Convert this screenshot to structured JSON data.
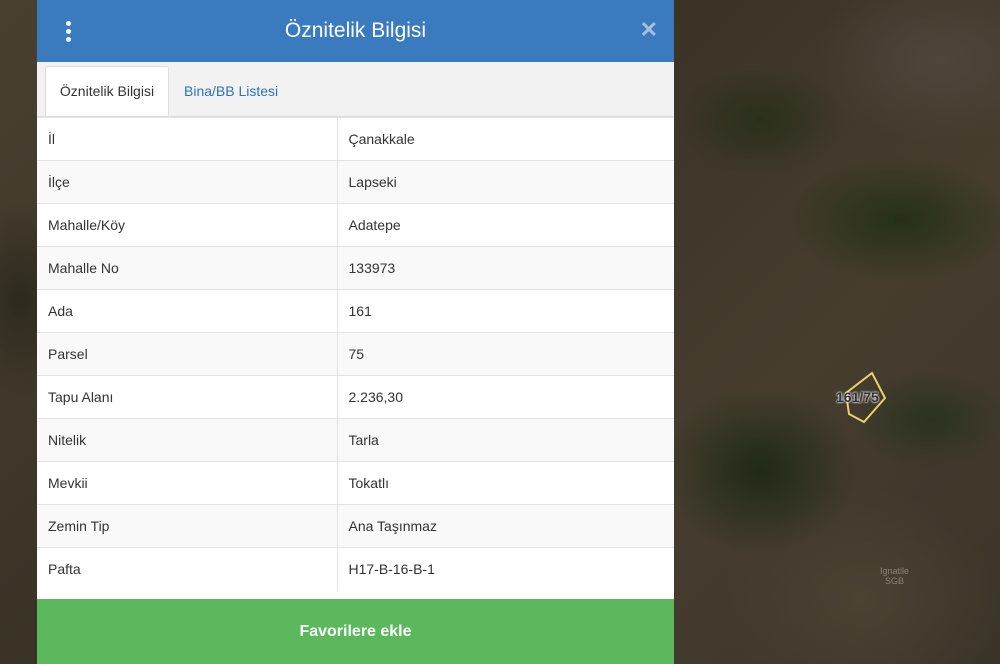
{
  "map": {
    "parcel_label": "161/75",
    "faint_label": "Ignatile\nSGB"
  },
  "panel": {
    "title": "Öznitelik Bilgisi",
    "close_glyph": "✕",
    "tabs": [
      {
        "label": "Öznitelik Bilgisi",
        "active": true
      },
      {
        "label": "Bina/BB Listesi",
        "active": false
      }
    ],
    "rows": [
      {
        "key": "İl",
        "value": "Çanakkale"
      },
      {
        "key": "İlçe",
        "value": "Lapseki"
      },
      {
        "key": "Mahalle/Köy",
        "value": "Adatepe"
      },
      {
        "key": "Mahalle No",
        "value": "133973"
      },
      {
        "key": "Ada",
        "value": "161"
      },
      {
        "key": "Parsel",
        "value": "75"
      },
      {
        "key": "Tapu Alanı",
        "value": "2.236,30"
      },
      {
        "key": "Nitelik",
        "value": "Tarla"
      },
      {
        "key": "Mevkii",
        "value": "Tokatlı"
      },
      {
        "key": "Zemin Tip",
        "value": "Ana Taşınmaz"
      },
      {
        "key": "Pafta",
        "value": "H17-B-16-B-1"
      }
    ],
    "favorite_button": "Favorilere ekle"
  },
  "colors": {
    "header": "#3a7bbf",
    "button": "#5cb85c",
    "tab_link": "#2f74b5"
  }
}
